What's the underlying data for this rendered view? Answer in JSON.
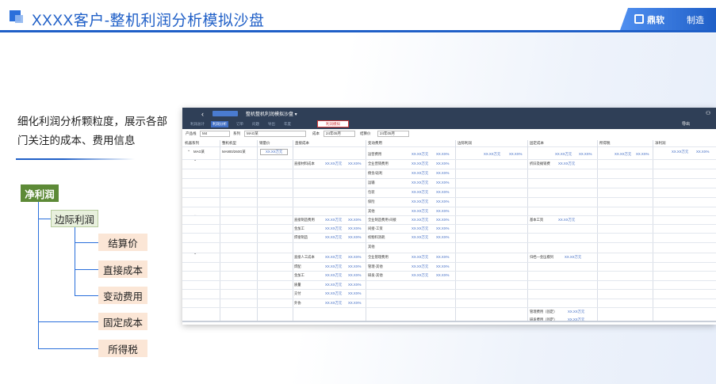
{
  "header": {
    "title": "XXXX客户-整机利润分析模拟沙盘",
    "brand_name": "鼎软",
    "brand_suffix": "制造"
  },
  "description": "细化利润分析颗粒度，展示各部门关注的成本、费用信息",
  "tree": {
    "root": "净利润",
    "level2": "边际利润",
    "leaves": [
      "结算价",
      "直接成本",
      "变动费用",
      "固定成本",
      "所得税"
    ]
  },
  "app": {
    "title": "整机整机利润模拟沙盘 ▾",
    "tabs": [
      "利润总计",
      "利润分析",
      "订单",
      "问题",
      "导出",
      "年度"
    ],
    "active_tab": 1,
    "red_button": "利润模拟",
    "export_label": "导出",
    "filters": {
      "product_label": "产品线",
      "product_value": "M4",
      "series_label": "系列",
      "series_value": "MAG某",
      "cost_label": "成本",
      "cost_value": "24年05月",
      "compare_label": "结算价",
      "compare_value": "24年05月"
    },
    "columns": [
      "机器系列",
      "整机机型",
      "销量价",
      "直接成本",
      "变动费用",
      "边际利润",
      "固定成本",
      "所得税",
      "净利润"
    ],
    "rows": {
      "series": "MAG某",
      "model": "MA900/260G某",
      "price_value": "XX.XX万元",
      "direct_items": [
        "直接材料成本",
        "直接制造费用",
        "金加工",
        "焊接制造",
        "直接人工成本",
        "焊配",
        "金加工",
        "质量",
        "交付",
        "外协"
      ],
      "variable_items": [
        "运营费用",
        "全业营销费用",
        "佣金/返利",
        "运输",
        "包装",
        "保险",
        "其他",
        "全业制造费用-间接",
        "间接-工资",
        "机物料消耗",
        "其他",
        "全业管理费用",
        "管理-其他",
        "研发-其他"
      ],
      "fixed_items": [
        "折旧及摊销费",
        "基本工资",
        "归档—金压模列",
        "管理费用（固定）",
        "研发费用（固定）"
      ],
      "value_text": "XX.XX万元",
      "pct_text": "XX.XX%"
    }
  }
}
